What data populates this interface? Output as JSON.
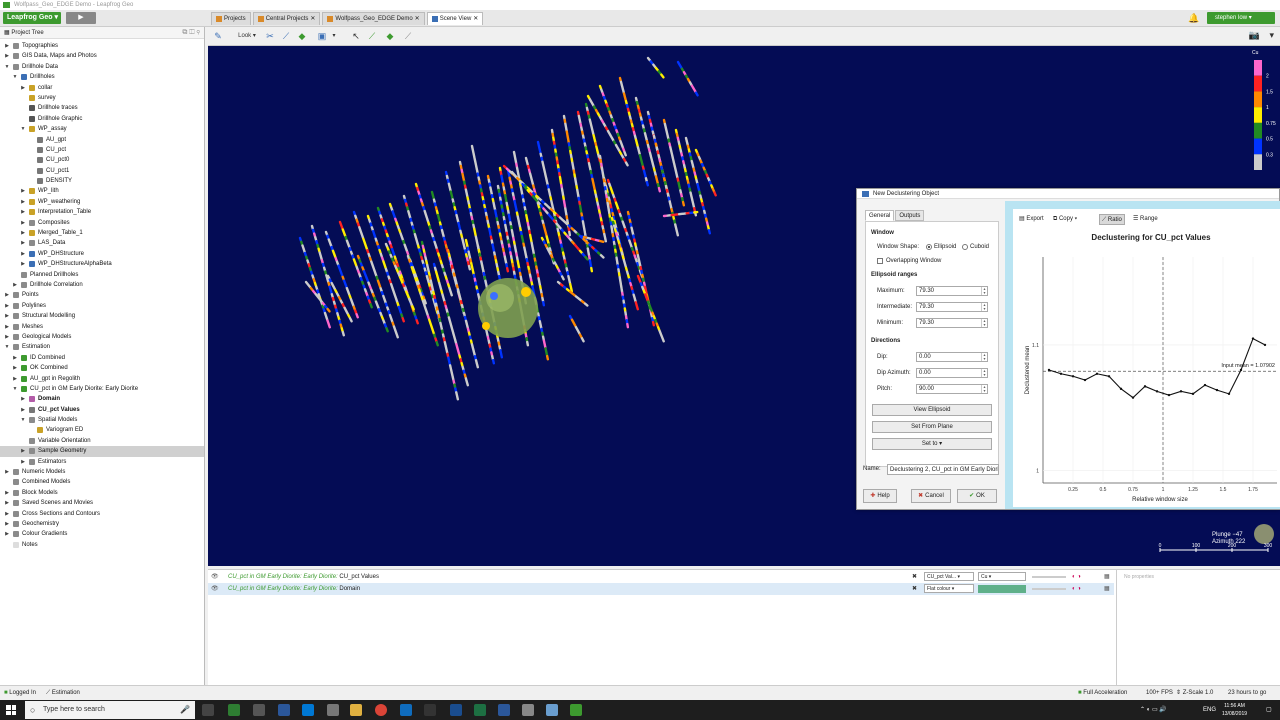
{
  "window_title": "Wolfpass_Geo_EDGE Demo - Leapfrog Geo",
  "topbar": {
    "app_button": "Leapfrog Geo",
    "user_button": "stephen low",
    "tabs": [
      {
        "label": "Projects"
      },
      {
        "label": "Central Projects"
      },
      {
        "label": "Wolfpass_Geo_EDGE Demo"
      },
      {
        "label": "Scene View"
      }
    ]
  },
  "left_panel": {
    "header": "Project Tree",
    "tree": [
      {
        "label": "Topographies",
        "level": 0,
        "arrow": "▶",
        "color": "#8b8b8b"
      },
      {
        "label": "GIS Data, Maps and Photos",
        "level": 0,
        "arrow": "▶",
        "color": "#8b8b8b"
      },
      {
        "label": "Drillhole Data",
        "level": 0,
        "arrow": "▼",
        "color": "#8b8b8b"
      },
      {
        "label": "Drillholes",
        "level": 1,
        "arrow": "▼",
        "color": "#3b6fb5"
      },
      {
        "label": "collar",
        "level": 2,
        "arrow": "▶",
        "color": "#c9a227"
      },
      {
        "label": "survey",
        "level": 2,
        "arrow": "",
        "color": "#c9a227"
      },
      {
        "label": "Drillhole traces",
        "level": 2,
        "arrow": "",
        "color": "#555555"
      },
      {
        "label": "Drillhole Graphic",
        "level": 2,
        "arrow": "",
        "color": "#555555"
      },
      {
        "label": "WP_assay",
        "level": 2,
        "arrow": "▼",
        "color": "#c9a227"
      },
      {
        "label": "AU_gpt",
        "level": 3,
        "arrow": "",
        "color": "#777777"
      },
      {
        "label": "CU_pct",
        "level": 3,
        "arrow": "",
        "color": "#777777"
      },
      {
        "label": "CU_pct0",
        "level": 3,
        "arrow": "",
        "color": "#777777"
      },
      {
        "label": "CU_pct1",
        "level": 3,
        "arrow": "",
        "color": "#777777"
      },
      {
        "label": "DENSITY",
        "level": 3,
        "arrow": "",
        "color": "#777777"
      },
      {
        "label": "WP_lith",
        "level": 2,
        "arrow": "▶",
        "color": "#c9a227"
      },
      {
        "label": "WP_weathering",
        "level": 2,
        "arrow": "▶",
        "color": "#c9a227"
      },
      {
        "label": "Interpretation_Table",
        "level": 2,
        "arrow": "▶",
        "color": "#c9a227"
      },
      {
        "label": "Composites",
        "level": 2,
        "arrow": "▶",
        "color": "#8b8b8b"
      },
      {
        "label": "Merged_Table_1",
        "level": 2,
        "arrow": "▶",
        "color": "#c9a227"
      },
      {
        "label": "LAS_Data",
        "level": 2,
        "arrow": "▶",
        "color": "#8b8b8b"
      },
      {
        "label": "WP_DHStructure",
        "level": 2,
        "arrow": "▶",
        "color": "#3b6fb5"
      },
      {
        "label": "WP_DHStructureAlphaBeta",
        "level": 2,
        "arrow": "▶",
        "color": "#3b6fb5"
      },
      {
        "label": "Planned Drillholes",
        "level": 1,
        "arrow": "",
        "color": "#8b8b8b"
      },
      {
        "label": "Drillhole Correlation",
        "level": 1,
        "arrow": "▶",
        "color": "#8b8b8b"
      },
      {
        "label": "Points",
        "level": 0,
        "arrow": "▶",
        "color": "#8b8b8b"
      },
      {
        "label": "Polylines",
        "level": 0,
        "arrow": "▶",
        "color": "#8b8b8b"
      },
      {
        "label": "Structural Modelling",
        "level": 0,
        "arrow": "▶",
        "color": "#8b8b8b"
      },
      {
        "label": "Meshes",
        "level": 0,
        "arrow": "▶",
        "color": "#8b8b8b"
      },
      {
        "label": "Geological Models",
        "level": 0,
        "arrow": "▶",
        "color": "#8b8b8b"
      },
      {
        "label": "Estimation",
        "level": 0,
        "arrow": "▼",
        "color": "#8b8b8b"
      },
      {
        "label": "ID Combined",
        "level": 1,
        "arrow": "▶",
        "color": "#3d9a2f"
      },
      {
        "label": "OK Combined",
        "level": 1,
        "arrow": "▶",
        "color": "#3d9a2f"
      },
      {
        "label": "AU_gpt in Regolith",
        "level": 1,
        "arrow": "▶",
        "color": "#3d9a2f"
      },
      {
        "label": "CU_pct in GM Early Diorite: Early Diorite",
        "level": 1,
        "arrow": "▼",
        "color": "#3d9a2f"
      },
      {
        "label": "Domain",
        "level": 2,
        "arrow": "▶",
        "color": "#b35ca8",
        "bold": true
      },
      {
        "label": "CU_pct Values",
        "level": 2,
        "arrow": "▶",
        "color": "#777777",
        "bold": true
      },
      {
        "label": "Spatial Models",
        "level": 2,
        "arrow": "▼",
        "color": "#8b8b8b"
      },
      {
        "label": "Variogram ED",
        "level": 3,
        "arrow": "",
        "color": "#c9a227"
      },
      {
        "label": "Variable Orientation",
        "level": 2,
        "arrow": "",
        "color": "#8b8b8b"
      },
      {
        "label": "Sample Geometry",
        "level": 2,
        "arrow": "▶",
        "color": "#8b8b8b",
        "selected": true
      },
      {
        "label": "Estimators",
        "level": 2,
        "arrow": "▶",
        "color": "#8b8b8b"
      },
      {
        "label": "Numeric Models",
        "level": 0,
        "arrow": "▶",
        "color": "#8b8b8b"
      },
      {
        "label": "Combined Models",
        "level": 0,
        "arrow": "",
        "color": "#8b8b8b"
      },
      {
        "label": "Block Models",
        "level": 0,
        "arrow": "▶",
        "color": "#8b8b8b"
      },
      {
        "label": "Saved Scenes and Movies",
        "level": 0,
        "arrow": "▶",
        "color": "#8b8b8b"
      },
      {
        "label": "Cross Sections and Contours",
        "level": 0,
        "arrow": "▶",
        "color": "#8b8b8b"
      },
      {
        "label": "Geochemistry",
        "level": 0,
        "arrow": "▶",
        "color": "#8b8b8b"
      },
      {
        "label": "Colour Gradients",
        "level": 0,
        "arrow": "▶",
        "color": "#8b8b8b"
      },
      {
        "label": "Notes",
        "level": 0,
        "arrow": "",
        "color": "#dddddd"
      }
    ]
  },
  "scene_toolbar": {
    "look_label": "Look"
  },
  "scene": {
    "legend": {
      "title": "Cu",
      "labels": [
        "2",
        "1.5",
        "1",
        "0.75",
        "0.5",
        "0.3"
      ],
      "colors": [
        "#ff66cc",
        "#ff2222",
        "#ff8800",
        "#ffee00",
        "#228b22",
        "#0033ff",
        "#cccccc"
      ]
    },
    "plunge": "Plunge −47",
    "azimuth": "Azimuth 222",
    "scale_labels": [
      "0",
      "100",
      "200",
      "300"
    ]
  },
  "dialog": {
    "title": "New Declustering Object",
    "tabs": [
      "General",
      "Outputs"
    ],
    "window_heading": "Window",
    "window_shape_label": "Window Shape:",
    "shape_options": [
      "Ellipsoid",
      "Cuboid"
    ],
    "overlapping_label": "Overlapping Window",
    "ellipsoid_heading": "Ellipsoid ranges",
    "maximum_label": "Maximum:",
    "maximum_value": "79.30",
    "intermediate_label": "Intermediate:",
    "intermediate_value": "79.30",
    "minimum_label": "Minimum:",
    "minimum_value": "79.30",
    "directions_heading": "Directions",
    "dip_label": "Dip:",
    "dip_value": "0.00",
    "dip_azimuth_label": "Dip Azimuth:",
    "dip_azimuth_value": "0.00",
    "pitch_label": "Pitch:",
    "pitch_value": "90.00",
    "view_ellipsoid_button": "View Ellipsoid",
    "set_from_plane_button": "Set From Plane",
    "set_to_button": "Set to",
    "name_label": "Name:",
    "name_value": "Declustering 2, CU_pct in GM Early Diorite",
    "help_button": "Help",
    "cancel_button": "Cancel",
    "ok_button": "OK"
  },
  "chart_toolbar": {
    "export": "Export",
    "copy": "Copy",
    "ratio": "Ratio",
    "range": "Range"
  },
  "chart_data": {
    "type": "line",
    "title": "Declustering for CU_pct Values",
    "xlabel": "Relative window size",
    "ylabel": "Declustered mean",
    "x_ticks": [
      "0.25",
      "0.5",
      "0.75",
      "1",
      "1.25",
      "1.5",
      "1.75"
    ],
    "y_ticks": [
      "1.1",
      "1"
    ],
    "x": [
      0.05,
      0.15,
      0.25,
      0.35,
      0.45,
      0.55,
      0.65,
      0.75,
      0.85,
      0.95,
      1.05,
      1.15,
      1.25,
      1.35,
      1.45,
      1.55,
      1.65,
      1.75,
      1.85
    ],
    "values": [
      1.08,
      1.077,
      1.075,
      1.072,
      1.077,
      1.075,
      1.065,
      1.058,
      1.067,
      1.063,
      1.06,
      1.063,
      1.061,
      1.068,
      1.064,
      1.061,
      1.08,
      1.105,
      1.1,
      1.085
    ],
    "xlim": [
      0,
      1.95
    ],
    "ylim": [
      0.99,
      1.17
    ],
    "reference_line": {
      "label": "Input mean = 1.07902",
      "value": 1.07902
    },
    "vertical_marker": 1.0
  },
  "bottom_panel": {
    "rows": [
      {
        "prefix": "CU_pct in GM Early Diorite: Early Diorite:",
        "name": "CU_pct Values",
        "select1": "CU_pct Val...",
        "select2": "Cu"
      },
      {
        "prefix": "CU_pct in GM Early Diorite: Early Diorite:",
        "name": "Domain",
        "select1": "Flat colour",
        "select2": ""
      }
    ],
    "no_properties": "No properties"
  },
  "status": {
    "logged_in": "Logged In",
    "estimation": "Estimation",
    "acceleration": "Full Acceleration",
    "fps": "100+ FPS",
    "zscale": "Z-Scale 1.0",
    "hours": "23 hours to go"
  },
  "taskbar": {
    "search_placeholder": "Type here to search",
    "lang": "ENG",
    "time": "11:56 AM",
    "date": "13/08/2019"
  }
}
